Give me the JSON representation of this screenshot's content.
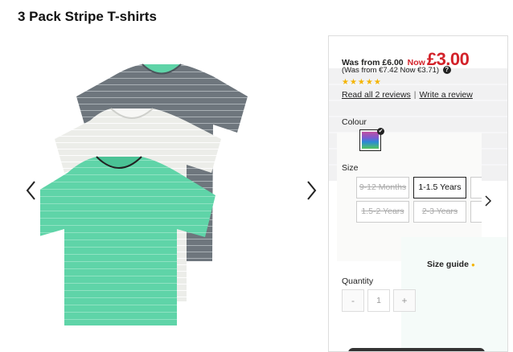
{
  "product": {
    "title": "3 Pack Stripe T-shirts"
  },
  "price": {
    "was": "Was from £6.00",
    "now_label": "Now",
    "now": "£3.00",
    "euro": "(Was from €7.42 Now €3.71)",
    "help_icon": "question-icon"
  },
  "rating": {
    "stars": "★★★★★",
    "value": 5,
    "out_of": 5
  },
  "reviews": {
    "read_label": "Read all 2 reviews",
    "separator": "|",
    "write_label": "Write a review"
  },
  "colour": {
    "label": "Colour",
    "selected_check": "✔"
  },
  "size": {
    "label": "Size",
    "options": [
      {
        "label": "9-12 Months",
        "available": false
      },
      {
        "label": "1-1.5 Years",
        "available": true,
        "selected": true
      },
      {
        "label": "1.5-2 Years",
        "available": false
      },
      {
        "label": "2-3 Years",
        "available": false
      }
    ],
    "guide_label": "Size guide",
    "guide_icon": "●"
  },
  "quantity": {
    "label": "Quantity",
    "minus": "-",
    "value": "1",
    "plus": "+"
  },
  "colors": {
    "accent_red": "#d3222a",
    "star_yellow": "#f4b400",
    "shirt_mint": "#5fd4a8",
    "shirt_grey": "#6e767d",
    "shirt_white": "#ecede9"
  }
}
